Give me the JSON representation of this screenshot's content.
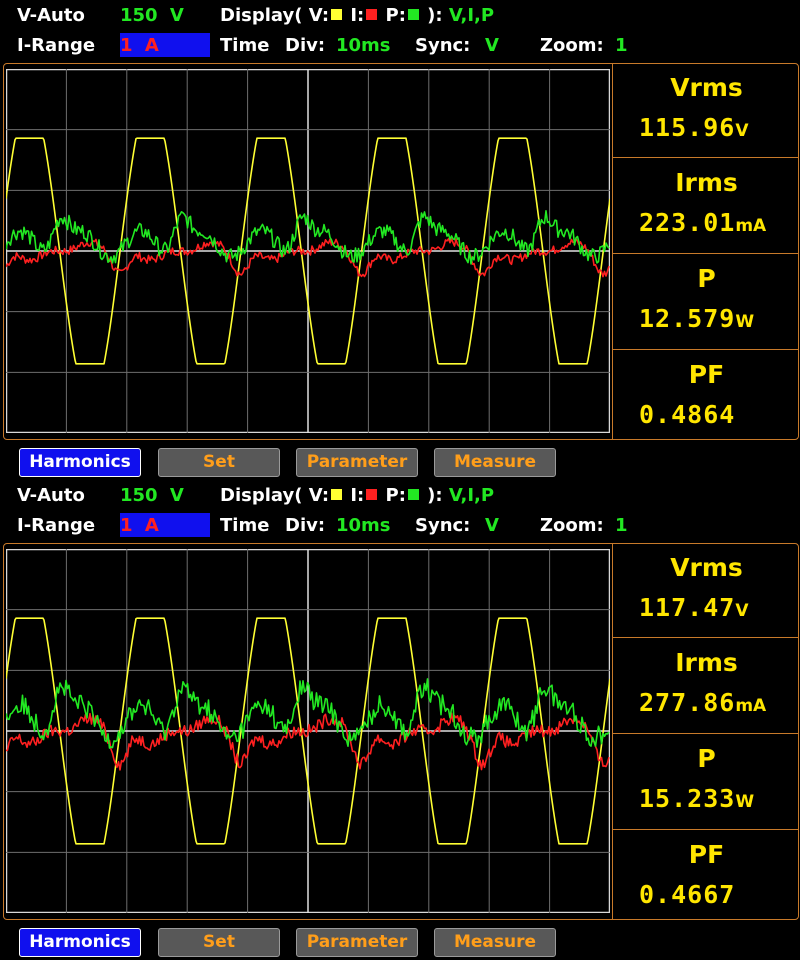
{
  "colors": {
    "voltage": "#ffff33",
    "current": "#ff2020",
    "power": "#22e822",
    "frame": "#c87a2a",
    "accent_blue": "#1010ee"
  },
  "panels": [
    {
      "header": {
        "range_mode": "V-Auto",
        "range_value": "150",
        "range_unit": "V",
        "display_prefix": "Display( V:",
        "display_i": "I:",
        "display_p": "P:",
        "display_suffix": "):",
        "display_channels": "V,I,P",
        "irange_label": "I-Range",
        "irange_value": "1",
        "irange_unit": "A",
        "time_label": "Time",
        "div_label": "Div:",
        "div_value": "10ms",
        "sync_label": "Sync:",
        "sync_value": "V",
        "zoom_label": "Zoom:",
        "zoom_value": "1"
      },
      "measurements": [
        {
          "label": "Vrms",
          "value": "115.96",
          "unit": "V"
        },
        {
          "label": "Irms",
          "value": "223.01",
          "unit": "mA"
        },
        {
          "label": "P",
          "value": "12.579",
          "unit": "W"
        },
        {
          "label": "PF",
          "value": "0.4864",
          "unit": ""
        }
      ],
      "buttons": [
        "Harmonics",
        "Set",
        "Parameter",
        "Measure"
      ],
      "waveforms": {
        "voltage_amplitude": 0.62,
        "cycles": 5,
        "current_amplitude": 0.14,
        "power_amplitude": 0.2
      }
    },
    {
      "header": {
        "range_mode": "V-Auto",
        "range_value": "150",
        "range_unit": "V",
        "display_prefix": "Display( V:",
        "display_i": "I:",
        "display_p": "P:",
        "display_suffix": "):",
        "display_channels": "V,I,P",
        "irange_label": "I-Range",
        "irange_value": "1",
        "irange_unit": "A",
        "time_label": "Time",
        "div_label": "Div:",
        "div_value": "10ms",
        "sync_label": "Sync:",
        "sync_value": "V",
        "zoom_label": "Zoom:",
        "zoom_value": "1"
      },
      "measurements": [
        {
          "label": "Vrms",
          "value": "117.47",
          "unit": "V"
        },
        {
          "label": "Irms",
          "value": "277.86",
          "unit": "mA"
        },
        {
          "label": "P",
          "value": "15.233",
          "unit": "W"
        },
        {
          "label": "PF",
          "value": "0.4667",
          "unit": ""
        }
      ],
      "buttons": [
        "Harmonics",
        "Set",
        "Parameter",
        "Measure"
      ],
      "waveforms": {
        "voltage_amplitude": 0.62,
        "cycles": 5,
        "current_amplitude": 0.2,
        "power_amplitude": 0.26
      }
    }
  ]
}
